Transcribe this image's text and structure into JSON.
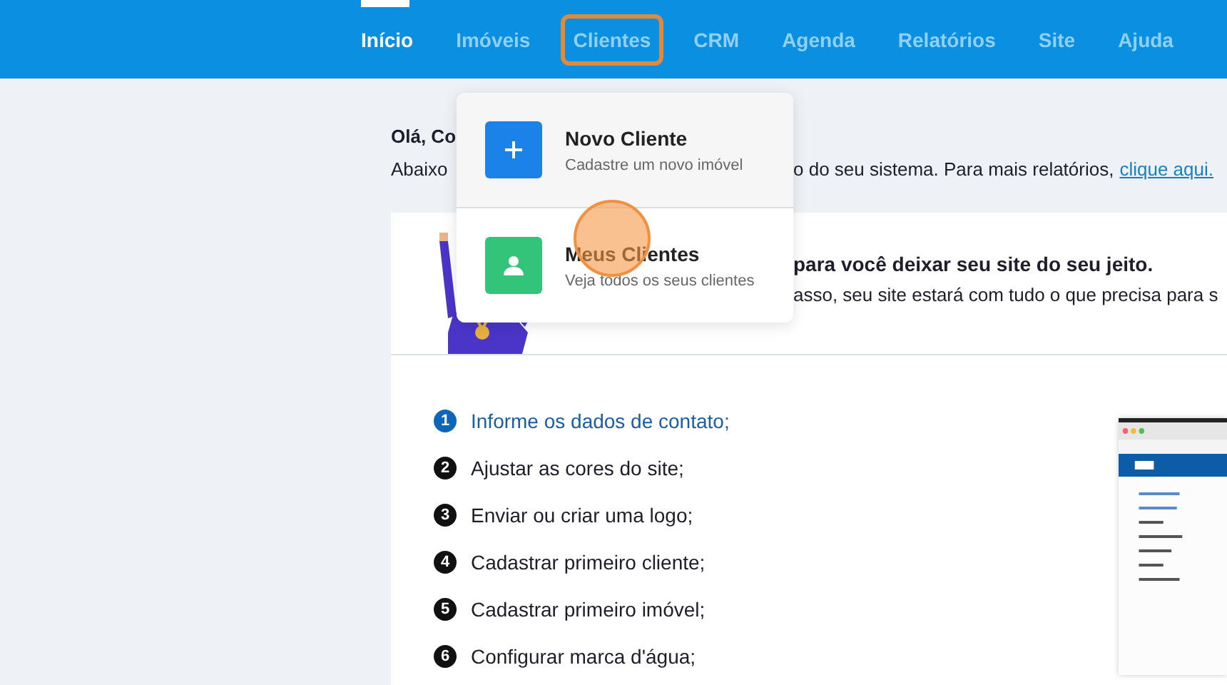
{
  "nav": {
    "items": [
      {
        "label": "Início",
        "selected": true,
        "highlighted": false
      },
      {
        "label": "Imóveis",
        "selected": false,
        "highlighted": false
      },
      {
        "label": "Clientes",
        "selected": false,
        "highlighted": true
      },
      {
        "label": "CRM",
        "selected": false,
        "highlighted": false
      },
      {
        "label": "Agenda",
        "selected": false,
        "highlighted": false
      },
      {
        "label": "Relatórios",
        "selected": false,
        "highlighted": false
      },
      {
        "label": "Site",
        "selected": false,
        "highlighted": false
      },
      {
        "label": "Ajuda",
        "selected": false,
        "highlighted": false
      }
    ]
  },
  "dropdown": {
    "items": [
      {
        "kind": "add",
        "title": "Novo Cliente",
        "subtitle": "Cadastre um novo imóvel",
        "clicked": false
      },
      {
        "kind": "person",
        "title": "Meus Clientes",
        "subtitle": "Veja todos os seus clientes",
        "clicked": true
      }
    ]
  },
  "greeting": "Olá, Co",
  "intro": {
    "left": "Abaixo",
    "right": "o do seu sistema. Para mais relatórios,",
    "link": "clique aqui."
  },
  "card": {
    "heading": "para você deixar seu site do seu jeito.",
    "text": "asso, seu site estará com tudo o que precisa para s",
    "steps": [
      {
        "number": "1",
        "label": "Informe os dados de contato;",
        "selected": true
      },
      {
        "number": "2",
        "label": "Ajustar as cores do site;",
        "selected": false
      },
      {
        "number": "3",
        "label": "Enviar ou criar uma logo;",
        "selected": false
      },
      {
        "number": "4",
        "label": "Cadastrar primeiro cliente;",
        "selected": false
      },
      {
        "number": "5",
        "label": "Cadastrar primeiro imóvel;",
        "selected": false
      },
      {
        "number": "6",
        "label": "Configurar marca d'água;",
        "selected": false
      }
    ]
  }
}
